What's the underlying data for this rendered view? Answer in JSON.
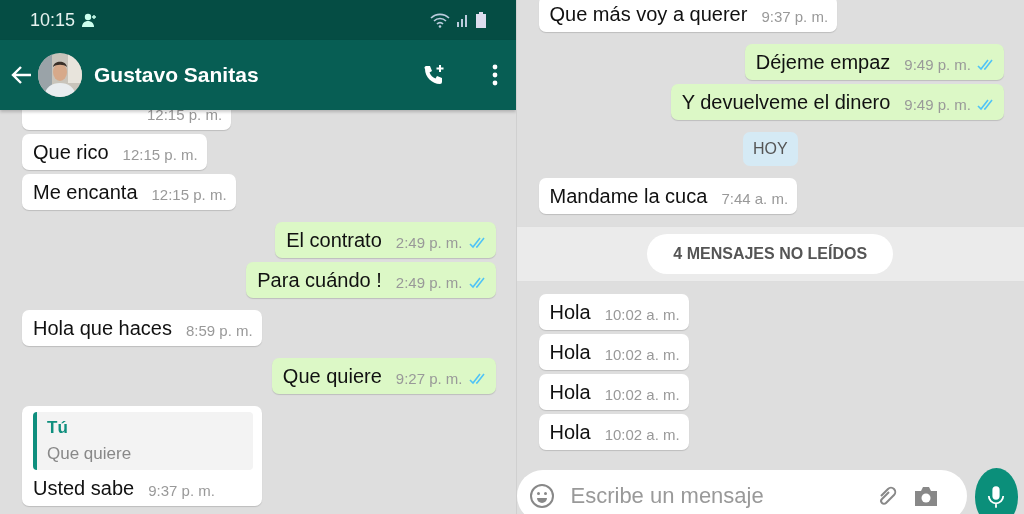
{
  "left": {
    "status_bar": {
      "time": "10:15"
    },
    "header": {
      "contact": "Gustavo Sanitas"
    },
    "messages": [
      {
        "kind": "in",
        "time": "12:15 p. m."
      },
      {
        "kind": "in",
        "text": "Que rico",
        "time": "12:15 p. m."
      },
      {
        "kind": "in",
        "text": "Me encanta",
        "time": "12:15 p. m."
      },
      {
        "kind": "out",
        "text": "El contrato",
        "time": "2:49 p. m.",
        "read": true
      },
      {
        "kind": "out",
        "text": "Para cuándo !",
        "time": "2:49 p. m.",
        "read": true
      },
      {
        "kind": "in",
        "text": "Hola que haces",
        "time": "8:59 p. m."
      },
      {
        "kind": "out",
        "text": "Que quiere",
        "time": "9:27 p. m.",
        "read": true
      },
      {
        "kind": "in",
        "text": "Usted sabe",
        "time": "9:37 p. m.",
        "quote": {
          "author": "Tú",
          "text": "Que quiere"
        }
      }
    ]
  },
  "right": {
    "messages": [
      {
        "kind": "in",
        "text": "Que más voy a querer",
        "time": "9:37 p. m."
      },
      {
        "kind": "out",
        "text": "Déjeme empaz",
        "time": "9:49 p. m.",
        "read": true
      },
      {
        "kind": "out",
        "text": "Y devuelveme el dinero",
        "time": "9:49 p. m.",
        "read": true
      },
      {
        "kind": "date",
        "text": "HOY"
      },
      {
        "kind": "in",
        "text": "Mandame la cuca",
        "time": "7:44 a. m."
      },
      {
        "kind": "unread",
        "text": "4 MENSAJES NO LEÍDOS"
      },
      {
        "kind": "in",
        "text": "Hola",
        "time": "10:02 a. m."
      },
      {
        "kind": "in",
        "text": "Hola",
        "time": "10:02 a. m."
      },
      {
        "kind": "in",
        "text": "Hola",
        "time": "10:02 a. m."
      },
      {
        "kind": "in",
        "text": "Hola",
        "time": "10:02 a. m."
      }
    ],
    "composer": {
      "placeholder": "Escribe un mensaje"
    }
  }
}
